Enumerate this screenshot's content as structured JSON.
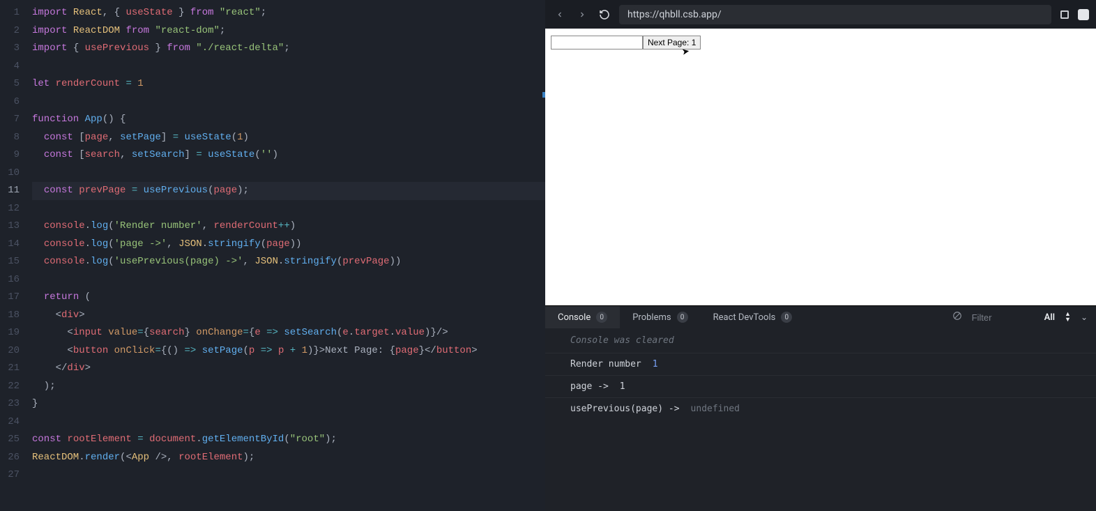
{
  "editor": {
    "line_count": 27,
    "active_line": 11,
    "code_lines": [
      [
        [
          "kw",
          "import"
        ],
        [
          "pn",
          " "
        ],
        [
          "cls",
          "React"
        ],
        [
          "pn",
          ", { "
        ],
        [
          "var",
          "useState"
        ],
        [
          "pn",
          " } "
        ],
        [
          "kw",
          "from"
        ],
        [
          "pn",
          " "
        ],
        [
          "str",
          "\"react\""
        ],
        [
          "pn",
          ";"
        ]
      ],
      [
        [
          "kw",
          "import"
        ],
        [
          "pn",
          " "
        ],
        [
          "cls",
          "ReactDOM"
        ],
        [
          "pn",
          " "
        ],
        [
          "kw",
          "from"
        ],
        [
          "pn",
          " "
        ],
        [
          "str",
          "\"react-dom\""
        ],
        [
          "pn",
          ";"
        ]
      ],
      [
        [
          "kw",
          "import"
        ],
        [
          "pn",
          " { "
        ],
        [
          "var",
          "usePrevious"
        ],
        [
          "pn",
          " } "
        ],
        [
          "kw",
          "from"
        ],
        [
          "pn",
          " "
        ],
        [
          "str",
          "\"./react-delta\""
        ],
        [
          "pn",
          ";"
        ]
      ],
      [],
      [
        [
          "kw",
          "let"
        ],
        [
          "pn",
          " "
        ],
        [
          "var",
          "renderCount"
        ],
        [
          "pn",
          " "
        ],
        [
          "op",
          "="
        ],
        [
          "pn",
          " "
        ],
        [
          "num",
          "1"
        ]
      ],
      [],
      [
        [
          "kw",
          "function"
        ],
        [
          "pn",
          " "
        ],
        [
          "fn",
          "App"
        ],
        [
          "pn",
          "() {"
        ]
      ],
      [
        [
          "pn",
          "  "
        ],
        [
          "kw",
          "const"
        ],
        [
          "pn",
          " ["
        ],
        [
          "var",
          "page"
        ],
        [
          "pn",
          ", "
        ],
        [
          "fn",
          "setPage"
        ],
        [
          "pn",
          "] "
        ],
        [
          "op",
          "="
        ],
        [
          "pn",
          " "
        ],
        [
          "fn",
          "useState"
        ],
        [
          "pn",
          "("
        ],
        [
          "num",
          "1"
        ],
        [
          "pn",
          ")"
        ]
      ],
      [
        [
          "pn",
          "  "
        ],
        [
          "kw",
          "const"
        ],
        [
          "pn",
          " ["
        ],
        [
          "var",
          "search"
        ],
        [
          "pn",
          ", "
        ],
        [
          "fn",
          "setSearch"
        ],
        [
          "pn",
          "] "
        ],
        [
          "op",
          "="
        ],
        [
          "pn",
          " "
        ],
        [
          "fn",
          "useState"
        ],
        [
          "pn",
          "("
        ],
        [
          "str",
          "''"
        ],
        [
          "pn",
          ")"
        ]
      ],
      [],
      [
        [
          "pn",
          "  "
        ],
        [
          "kw",
          "const"
        ],
        [
          "pn",
          " "
        ],
        [
          "var",
          "prevPage"
        ],
        [
          "pn",
          " "
        ],
        [
          "op",
          "="
        ],
        [
          "pn",
          " "
        ],
        [
          "fn",
          "usePrevious"
        ],
        [
          "pn",
          "("
        ],
        [
          "var",
          "page"
        ],
        [
          "pn",
          ");"
        ]
      ],
      [],
      [
        [
          "pn",
          "  "
        ],
        [
          "var",
          "console"
        ],
        [
          "pn",
          "."
        ],
        [
          "fn",
          "log"
        ],
        [
          "pn",
          "("
        ],
        [
          "str",
          "'Render number'"
        ],
        [
          "pn",
          ", "
        ],
        [
          "var",
          "renderCount"
        ],
        [
          "op",
          "++"
        ],
        [
          "pn",
          ")"
        ]
      ],
      [
        [
          "pn",
          "  "
        ],
        [
          "var",
          "console"
        ],
        [
          "pn",
          "."
        ],
        [
          "fn",
          "log"
        ],
        [
          "pn",
          "("
        ],
        [
          "str",
          "'page ->'"
        ],
        [
          "pn",
          ", "
        ],
        [
          "cls",
          "JSON"
        ],
        [
          "pn",
          "."
        ],
        [
          "fn",
          "stringify"
        ],
        [
          "pn",
          "("
        ],
        [
          "var",
          "page"
        ],
        [
          "pn",
          "))"
        ]
      ],
      [
        [
          "pn",
          "  "
        ],
        [
          "var",
          "console"
        ],
        [
          "pn",
          "."
        ],
        [
          "fn",
          "log"
        ],
        [
          "pn",
          "("
        ],
        [
          "str",
          "'usePrevious(page) ->'"
        ],
        [
          "pn",
          ", "
        ],
        [
          "cls",
          "JSON"
        ],
        [
          "pn",
          "."
        ],
        [
          "fn",
          "stringify"
        ],
        [
          "pn",
          "("
        ],
        [
          "var",
          "prevPage"
        ],
        [
          "pn",
          "))"
        ]
      ],
      [],
      [
        [
          "pn",
          "  "
        ],
        [
          "kw",
          "return"
        ],
        [
          "pn",
          " ("
        ]
      ],
      [
        [
          "pn",
          "    <"
        ],
        [
          "tag",
          "div"
        ],
        [
          "pn",
          ">"
        ]
      ],
      [
        [
          "pn",
          "      <"
        ],
        [
          "tag",
          "input"
        ],
        [
          "pn",
          " "
        ],
        [
          "attr",
          "value"
        ],
        [
          "op",
          "="
        ],
        [
          "pn",
          "{"
        ],
        [
          "var",
          "search"
        ],
        [
          "pn",
          "} "
        ],
        [
          "attr",
          "onChange"
        ],
        [
          "op",
          "="
        ],
        [
          "pn",
          "{"
        ],
        [
          "var",
          "e"
        ],
        [
          "pn",
          " "
        ],
        [
          "op",
          "=>"
        ],
        [
          "pn",
          " "
        ],
        [
          "fn",
          "setSearch"
        ],
        [
          "pn",
          "("
        ],
        [
          "var",
          "e"
        ],
        [
          "pn",
          "."
        ],
        [
          "var",
          "target"
        ],
        [
          "pn",
          "."
        ],
        [
          "var",
          "value"
        ],
        [
          "pn",
          ")}/>"
        ]
      ],
      [
        [
          "pn",
          "      <"
        ],
        [
          "tag",
          "button"
        ],
        [
          "pn",
          " "
        ],
        [
          "attr",
          "onClick"
        ],
        [
          "op",
          "="
        ],
        [
          "pn",
          "{() "
        ],
        [
          "op",
          "=>"
        ],
        [
          "pn",
          " "
        ],
        [
          "fn",
          "setPage"
        ],
        [
          "pn",
          "("
        ],
        [
          "var",
          "p"
        ],
        [
          "pn",
          " "
        ],
        [
          "op",
          "=>"
        ],
        [
          "pn",
          " "
        ],
        [
          "var",
          "p"
        ],
        [
          "pn",
          " "
        ],
        [
          "op",
          "+"
        ],
        [
          "pn",
          " "
        ],
        [
          "num",
          "1"
        ],
        [
          "pn",
          ")}>Next Page: {"
        ],
        [
          "var",
          "page"
        ],
        [
          "pn",
          "}</"
        ],
        [
          "tag",
          "button"
        ],
        [
          "pn",
          ">"
        ]
      ],
      [
        [
          "pn",
          "    </"
        ],
        [
          "tag",
          "div"
        ],
        [
          "pn",
          ">"
        ]
      ],
      [
        [
          "pn",
          "  );"
        ]
      ],
      [
        [
          "pn",
          "}"
        ]
      ],
      [],
      [
        [
          "kw",
          "const"
        ],
        [
          "pn",
          " "
        ],
        [
          "var",
          "rootElement"
        ],
        [
          "pn",
          " "
        ],
        [
          "op",
          "="
        ],
        [
          "pn",
          " "
        ],
        [
          "var",
          "document"
        ],
        [
          "pn",
          "."
        ],
        [
          "fn",
          "getElementById"
        ],
        [
          "pn",
          "("
        ],
        [
          "str",
          "\"root\""
        ],
        [
          "pn",
          ");"
        ]
      ],
      [
        [
          "cls",
          "ReactDOM"
        ],
        [
          "pn",
          "."
        ],
        [
          "fn",
          "render"
        ],
        [
          "pn",
          "(<"
        ],
        [
          "cls",
          "App"
        ],
        [
          "pn",
          " />, "
        ],
        [
          "var",
          "rootElement"
        ],
        [
          "pn",
          ");"
        ]
      ],
      []
    ]
  },
  "toolbar": {
    "url": "https://qhbll.csb.app/"
  },
  "preview": {
    "input_value": "",
    "button_label": "Next Page: 1"
  },
  "devtools": {
    "tabs": [
      {
        "label": "Console",
        "count": "0",
        "active": true
      },
      {
        "label": "Problems",
        "count": "0",
        "active": false
      },
      {
        "label": "React DevTools",
        "count": "0",
        "active": false
      }
    ],
    "filter_placeholder": "Filter",
    "level": "All",
    "cleared_msg": "Console was cleared",
    "logs": [
      {
        "msg": "Render number",
        "val": "1",
        "val_class": "log-val-num"
      },
      {
        "msg": "page ->",
        "val": "1",
        "val_class": ""
      },
      {
        "msg": "usePrevious(page) ->",
        "val": "undefined",
        "val_class": "log-val-undef"
      }
    ]
  }
}
